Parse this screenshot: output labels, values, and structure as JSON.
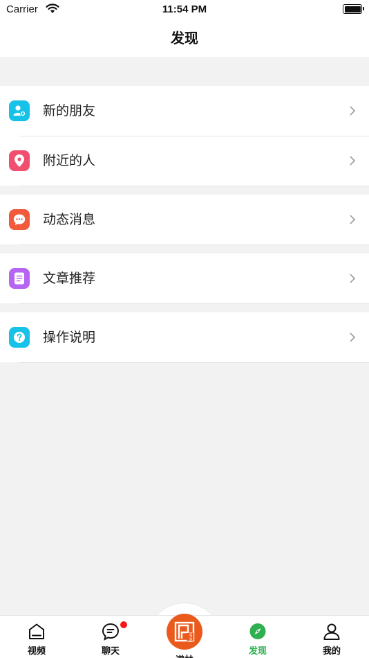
{
  "status": {
    "carrier": "Carrier",
    "time": "11:54 PM"
  },
  "header": {
    "title": "发现"
  },
  "menu": [
    {
      "label": "新的朋友",
      "icon": "add-friend-icon",
      "color": "#17c2e8"
    },
    {
      "label": "附近的人",
      "icon": "location-pin-icon",
      "color": "#f0506e"
    },
    {
      "label": "动态消息",
      "icon": "chat-bubble-icon",
      "color": "#f25a3c"
    },
    {
      "label": "文章推荐",
      "icon": "document-icon",
      "color": "#b565f2"
    },
    {
      "label": "操作说明",
      "icon": "help-icon",
      "color": "#17c2e8"
    }
  ],
  "tabs": [
    {
      "label": "视频",
      "icon": "home-icon"
    },
    {
      "label": "聊天",
      "icon": "chat-icon",
      "badge": true
    },
    {
      "label": "谱林",
      "icon": "pulin-logo"
    },
    {
      "label": "发现",
      "icon": "compass-icon",
      "active": true
    },
    {
      "label": "我的",
      "icon": "person-icon"
    }
  ],
  "colors": {
    "accent_green": "#2fb050",
    "logo_orange": "#ea5a1d",
    "badge_red": "#f5191e"
  }
}
